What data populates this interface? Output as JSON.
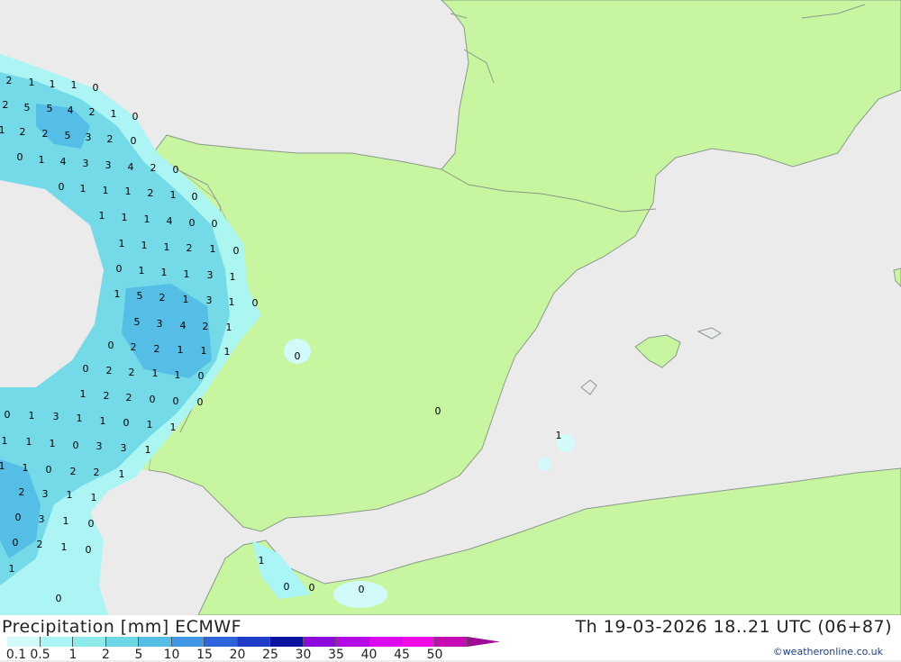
{
  "header": {
    "title_left": "Precipitation [mm] ECMWF",
    "title_right": "Th 19-03-2026 18..21 UTC (06+87)",
    "credit": "©weatheronline.co.uk"
  },
  "legend": {
    "labels": [
      "0.1",
      "0.5",
      "1",
      "2",
      "5",
      "10",
      "15",
      "20",
      "25",
      "30",
      "35",
      "40",
      "45",
      "50"
    ],
    "colors": [
      "#d2fafa",
      "#aaf5f5",
      "#8ceaea",
      "#6ed7e6",
      "#55bee6",
      "#4196e6",
      "#2d64dc",
      "#1e3cc8",
      "#0a14a0",
      "#8c0adc",
      "#b40ae6",
      "#dc0af0",
      "#f00ae6",
      "#c80ab4"
    ]
  },
  "colors": {
    "sea": "#ebebeb",
    "land": "#c8f5a0",
    "border": "#8a9a8a",
    "precip_light": "#aaf5f5",
    "precip_mid": "#6ed7e6",
    "precip_heavy": "#55bee6"
  },
  "map_values": [
    "2",
    "1",
    "1",
    "1",
    "0",
    "2",
    "5",
    "5",
    "4",
    "2",
    "1",
    "0",
    "1",
    "2",
    "2",
    "5",
    "3",
    "2",
    "0",
    "0",
    "1",
    "4",
    "3",
    "3",
    "4",
    "2",
    "0",
    "0",
    "1",
    "1",
    "1",
    "2",
    "1",
    "0",
    "1",
    "1",
    "1",
    "4",
    "0",
    "0",
    "1",
    "1",
    "1",
    "2",
    "1",
    "0",
    "0",
    "1",
    "1",
    "1",
    "3",
    "1",
    "1",
    "5",
    "2",
    "1",
    "3",
    "1",
    "0",
    "5",
    "3",
    "4",
    "2",
    "1",
    "0",
    "2",
    "2",
    "1",
    "1",
    "1",
    "0",
    "0",
    "2",
    "2",
    "1",
    "1",
    "0",
    "1",
    "2",
    "2",
    "0",
    "0",
    "0",
    "0",
    "0",
    "1",
    "3",
    "1",
    "1",
    "0",
    "1",
    "1",
    "1",
    "1",
    "1",
    "1",
    "0",
    "3",
    "3",
    "1",
    "1",
    "1",
    "0",
    "2",
    "2",
    "1",
    "2",
    "3",
    "1",
    "1",
    "0",
    "3",
    "1",
    "0",
    "0",
    "2",
    "1",
    "0",
    "1",
    "1",
    "0",
    "0",
    "0",
    "0",
    "0",
    "0",
    "0"
  ]
}
